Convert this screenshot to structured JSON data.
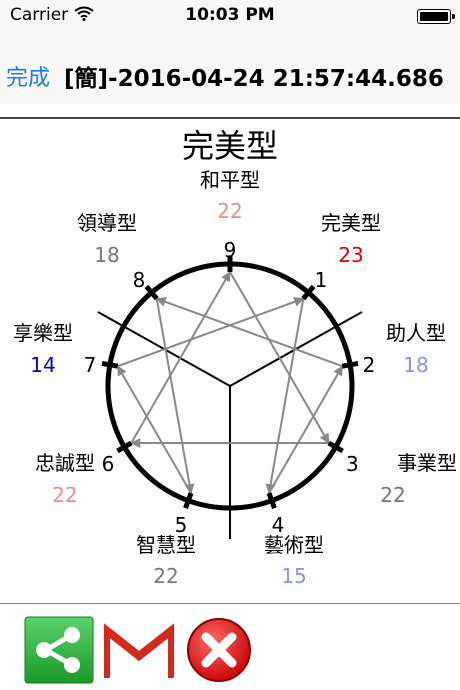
{
  "status_bar": {
    "carrier": "Carrier",
    "time": "10:03 PM"
  },
  "nav": {
    "done_label": "完成",
    "title": "[簡]-2016-04-24 21:57:44.686"
  },
  "chart": {
    "main_title": "完美型",
    "types": [
      {
        "number": "1",
        "name": "完美型",
        "score": "23",
        "color": "#e60000"
      },
      {
        "number": "2",
        "name": "助人型",
        "score": "18",
        "color": "#8f8ff0"
      },
      {
        "number": "3",
        "name": "事業型",
        "score": "22",
        "color": "#777777"
      },
      {
        "number": "4",
        "name": "藝術型",
        "score": "15",
        "color": "#8f8ff0"
      },
      {
        "number": "5",
        "name": "智慧型",
        "score": "22",
        "color": "#777777"
      },
      {
        "number": "6",
        "name": "忠誠型",
        "score": "22",
        "color": "#f28a8a"
      },
      {
        "number": "7",
        "name": "享樂型",
        "score": "14",
        "color": "#0000dd"
      },
      {
        "number": "8",
        "name": "領導型",
        "score": "18",
        "color": "#777777"
      },
      {
        "number": "9",
        "name": "和平型",
        "score": "22",
        "color": "#f28a8a"
      }
    ]
  },
  "toolbar": {
    "share": "share-icon",
    "gmail": "gmail-icon",
    "close": "close-icon"
  }
}
